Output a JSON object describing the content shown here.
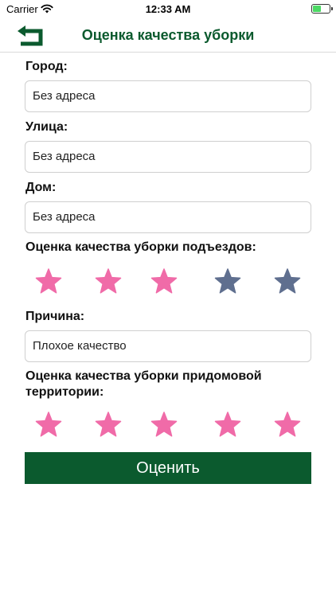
{
  "status_bar": {
    "carrier": "Carrier",
    "time": "12:33 AM",
    "wifi_icon": "wifi-icon",
    "battery_icon": "battery-icon"
  },
  "nav": {
    "title": "Оценка качества уборки",
    "back_icon": "back-arrow-icon",
    "accent": "#0b5a2e"
  },
  "form": {
    "city": {
      "label": "Город:",
      "value": "Без адреса"
    },
    "street": {
      "label": "Улица:",
      "value": "Без адреса"
    },
    "house": {
      "label": "Дом:",
      "value": "Без адреса"
    },
    "entrance_rating": {
      "label": "Оценка качества уборки подъездов:",
      "rating": 3,
      "max": 5
    },
    "reason": {
      "label": "Причина:",
      "value": "Плохое качество"
    },
    "territory_rating": {
      "label_line1": "Оценка качества уборки придомовой",
      "label_line2": "территории:",
      "rating": 5,
      "max": 5
    },
    "submit_label": "Оценить"
  },
  "colors": {
    "star_active": "#f06ba8",
    "star_inactive": "#5f6f8f",
    "button_bg": "#0b5a2e"
  }
}
